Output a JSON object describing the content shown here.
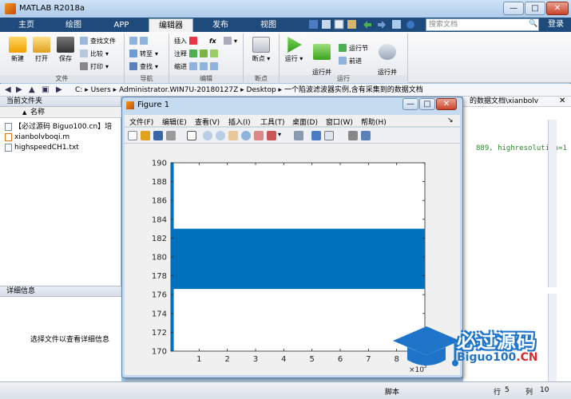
{
  "window": {
    "title": "MATLAB R2018a"
  },
  "ribbon_tabs": [
    {
      "label": "主页",
      "active": false
    },
    {
      "label": "绘图",
      "active": false
    },
    {
      "label": "APP",
      "active": false
    },
    {
      "label": "编辑器",
      "active": true
    },
    {
      "label": "发布",
      "active": false
    },
    {
      "label": "视图",
      "active": false
    }
  ],
  "search": {
    "placeholder": "搜索文档"
  },
  "login_label": "登录",
  "ribbon": {
    "file_group": {
      "label": "文件",
      "new": "新建",
      "open": "打开",
      "save": "保存",
      "find_files": "查找文件",
      "compare": "比较",
      "print": "打印"
    },
    "nav_group": {
      "label": "导航",
      "goto": "转至",
      "find": "查找"
    },
    "edit_group": {
      "label": "编辑",
      "insert": "插入",
      "comment": "注释",
      "indent": "缩进",
      "fx": "fx"
    },
    "breakpoint_group": {
      "label": "断点",
      "breakpoints": "断点"
    },
    "run_group": {
      "label": "运行",
      "run": "运行",
      "run_advance": "运行并\n前进",
      "run_section": "运行节",
      "advance": "前进",
      "run_time": "运行并\n计时"
    }
  },
  "address": {
    "crumbs": [
      "C:",
      "Users",
      "Administrator.WIN7U-20180127Z",
      "Desktop",
      "一个陷波滤波器实例,含有采集到的数据文档"
    ]
  },
  "current_folder": {
    "title": "当前文件夹",
    "column_name": "名称",
    "sort_arrow": "▲",
    "files": [
      {
        "name": "【必过源码 Biguo100.cn】培",
        "type": "txt"
      },
      {
        "name": "xianbolvboqi.m",
        "type": "m"
      },
      {
        "name": "highspeedCH1.txt",
        "type": "txt"
      }
    ]
  },
  "details": {
    "title": "详细信息",
    "empty_text": "选择文件以查看详细信息"
  },
  "editor_tab": {
    "label": "的数据文档\\xianbolv"
  },
  "editor_code": "889, highresolution=1",
  "figure": {
    "title": "Figure 1",
    "menu": [
      "文件(F)",
      "编辑(E)",
      "查看(V)",
      "插入(I)",
      "工具(T)",
      "桌面(D)",
      "窗口(W)",
      "帮助(H)"
    ]
  },
  "chart_data": {
    "type": "line",
    "title": "",
    "xlabel": "",
    "ylabel": "",
    "xlim": [
      0,
      9
    ],
    "ylim": [
      170,
      190
    ],
    "x_multiplier": "×10^5",
    "x_multiplier_text": "×10",
    "x_multiplier_exp": "5",
    "xticks": [
      "1",
      "2",
      "3",
      "4",
      "5",
      "6",
      "7",
      "8",
      "9"
    ],
    "yticks": [
      "170",
      "172",
      "174",
      "176",
      "178",
      "180",
      "182",
      "184",
      "186",
      "188",
      "190"
    ],
    "series": [
      {
        "color": "#0072bd",
        "band_low": 176.6,
        "band_high": 183.0,
        "initial_transient": {
          "x_end": 0.1,
          "y_low": 170,
          "y_high": 190
        },
        "settled_from_x": 0.3
      }
    ],
    "grid": false
  },
  "status": {
    "script_label": "脚本",
    "row_label": "行",
    "row_value": "5",
    "col_label": "列",
    "col_value": "10"
  },
  "watermark": {
    "cn": "必过源码",
    "en_main": "Biguo100",
    "en_suffix": ".CN"
  }
}
